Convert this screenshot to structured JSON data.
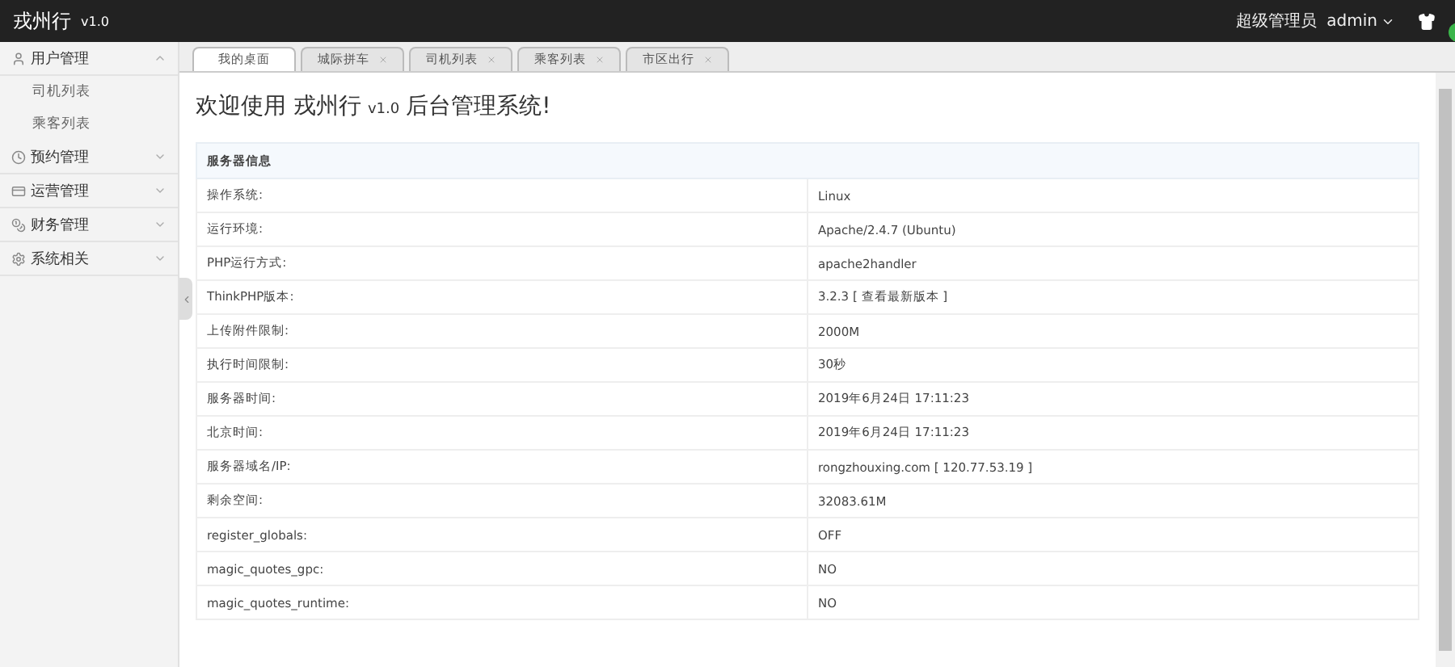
{
  "header": {
    "brand": "戎州行",
    "version": "v1.0",
    "role": "超级管理员",
    "user": "admin"
  },
  "sidebar": {
    "groups": [
      {
        "label": "用户管理",
        "expanded": true,
        "children": [
          {
            "label": "司机列表"
          },
          {
            "label": "乘客列表"
          }
        ]
      },
      {
        "label": "预约管理",
        "expanded": false
      },
      {
        "label": "运营管理",
        "expanded": false
      },
      {
        "label": "财务管理",
        "expanded": false
      },
      {
        "label": "系统相关",
        "expanded": false
      }
    ]
  },
  "tabs": [
    {
      "label": "我的桌面",
      "selected": true,
      "closable": false
    },
    {
      "label": "城际拼车",
      "selected": false,
      "closable": true
    },
    {
      "label": "司机列表",
      "selected": false,
      "closable": true
    },
    {
      "label": "乘客列表",
      "selected": false,
      "closable": true
    },
    {
      "label": "市区出行",
      "selected": false,
      "closable": true
    }
  ],
  "welcome": {
    "before": "欢迎使用 戎州行",
    "version": "v1.0",
    "after": "后台管理系统!"
  },
  "table": {
    "heading": "服务器信息",
    "rows": [
      [
        "操作系统:",
        "Linux"
      ],
      [
        "运行环境:",
        "Apache/2.4.7 (Ubuntu)"
      ],
      [
        "PHP运行方式:",
        "apache2handler"
      ],
      [
        "ThinkPHP版本:",
        "3.2.3 [ 查看最新版本 ]"
      ],
      [
        "上传附件限制:",
        "2000M"
      ],
      [
        "执行时间限制:",
        "30秒"
      ],
      [
        "服务器时间:",
        "2019年6月24日 17:11:23"
      ],
      [
        "北京时间:",
        "2019年6月24日 17:11:23"
      ],
      [
        "服务器域名/IP:",
        "rongzhouxing.com [ 120.77.53.19 ]"
      ],
      [
        "剩余空间:",
        "32083.61M"
      ],
      [
        "register_globals:",
        "OFF"
      ],
      [
        "magic_quotes_gpc:",
        "NO"
      ],
      [
        "magic_quotes_runtime:",
        "NO"
      ]
    ]
  }
}
